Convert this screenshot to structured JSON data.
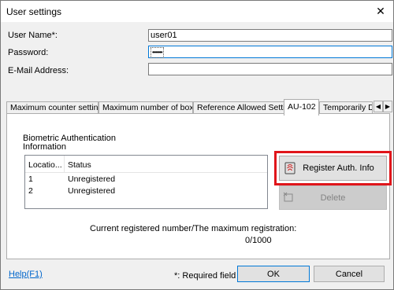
{
  "window": {
    "title": "User settings",
    "close_glyph": "✕"
  },
  "form": {
    "username_label": "User Name*:",
    "username_value": "user01",
    "password_label": "Password:",
    "password_value": "•••••••",
    "email_label": "E-Mail Address:",
    "email_value": ""
  },
  "tabs": [
    {
      "label": "Maximum counter settings",
      "active": false
    },
    {
      "label": "Maximum number of boxes",
      "active": false
    },
    {
      "label": "Reference Allowed Setting",
      "active": false
    },
    {
      "label": "AU-102",
      "active": true
    },
    {
      "label": "Temporarily Disa",
      "active": false
    }
  ],
  "tab_scroll": {
    "left_glyph": "◀",
    "right_glyph": "▶"
  },
  "biometric": {
    "section_label_line1": "Biometric Authentication",
    "section_label_line2": "Information",
    "columns": [
      "Locatio...",
      "Status"
    ],
    "rows": [
      {
        "location": "1",
        "status": "Unregistered"
      },
      {
        "location": "2",
        "status": "Unregistered"
      }
    ],
    "register_label": "Register Auth. Info",
    "register_icon": "fingerprint-scanner-icon",
    "delete_label": "Delete",
    "delete_icon": "delete-icon",
    "count_caption": "Current registered number/The maximum registration:",
    "count_value": "0/1000"
  },
  "footer": {
    "help_label": "Help(F1)",
    "required_note": "*: Required field",
    "ok_label": "OK",
    "cancel_label": "Cancel"
  },
  "colors": {
    "accent": "#0078d7",
    "highlight": "#e0151a",
    "link": "#0066cc"
  }
}
